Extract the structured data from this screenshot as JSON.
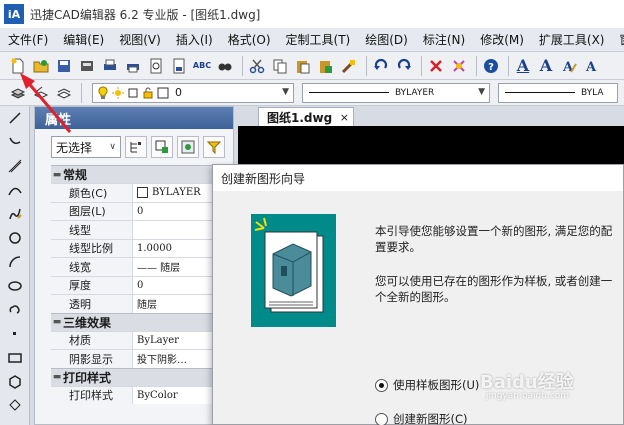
{
  "window": {
    "app_icon_text": "iA",
    "title": "迅捷CAD编辑器 6.2 专业版 - [图纸1.dwg]"
  },
  "menu": [
    "文件(F)",
    "编辑(E)",
    "视图(V)",
    "插入(I)",
    "格式(O)",
    "定制工具(T)",
    "绘图(D)",
    "标注(N)",
    "修改(M)",
    "扩展工具(X)",
    "窗口"
  ],
  "toolbar1": {
    "icons": [
      "new-file-icon",
      "open-folder-icon",
      "save-icon",
      "save-as-icon",
      "print-icon",
      "print-preview-icon",
      "page-setup-icon",
      "plot-icon",
      "spellcheck-icon",
      "find-icon",
      "cut-icon",
      "copy-icon",
      "paste-icon",
      "paste-special-icon",
      "match-properties-icon",
      "undo-icon",
      "redo-icon",
      "delete-icon",
      "purge-icon",
      "help-icon"
    ],
    "text_buttons": [
      "A",
      "A"
    ],
    "spellcheck_label": "ABC"
  },
  "toolbar2": {
    "layer_value": "0",
    "linetype_value": "BYLAYER",
    "lineweight_value": "BYLA"
  },
  "left_toolbar": {
    "icons": [
      "line-icon",
      "polyline-icon",
      "construction-line-icon",
      "arc-icon",
      "spline-icon",
      "circle-icon",
      "arc-tool-icon",
      "ellipse-icon",
      "revision-cloud-icon",
      "point-icon",
      "rectangle-icon",
      "polygon-icon",
      "hatch-icon"
    ]
  },
  "properties": {
    "title": "属性",
    "selection": "无选择",
    "sections": [
      {
        "name": "常规",
        "rows": [
          {
            "name": "颜色(C)",
            "value": "BYLAYER"
          },
          {
            "name": "图层(L)",
            "value": "0"
          },
          {
            "name": "线型",
            "value": ""
          },
          {
            "name": "线型比例",
            "value": "1.0000"
          },
          {
            "name": "线宽",
            "value": "—— 随层"
          },
          {
            "name": "厚度",
            "value": "0"
          },
          {
            "name": "透明",
            "value": "随层"
          }
        ]
      },
      {
        "name": "三维效果",
        "rows": [
          {
            "name": "材质",
            "value": "ByLayer"
          },
          {
            "name": "阴影显示",
            "value": "投下阴影…"
          }
        ]
      },
      {
        "name": "打印样式",
        "rows": [
          {
            "name": "打印样式",
            "value": "ByColor"
          }
        ]
      }
    ]
  },
  "document": {
    "tab_label": "图纸1.dwg",
    "tab_close": "×"
  },
  "dialog": {
    "title": "创建新图形向导",
    "text1": "本引导使您能够设置一个新的图形, 满足您的配置要求。",
    "text2": "您可以使用已存在的图形作为样板, 或者创建一个全新的图形。",
    "radio_template": "使用样板图形(U)",
    "radio_new": "创建新图形(C)",
    "selected": "radio_template"
  },
  "watermark": {
    "text": "Baidu经验",
    "sub": "jingyan.baidu.com"
  },
  "colors": {
    "accent": "#3f6299",
    "wizard_bg": "#008b8b",
    "annotation_arrow": "#e0202a"
  }
}
